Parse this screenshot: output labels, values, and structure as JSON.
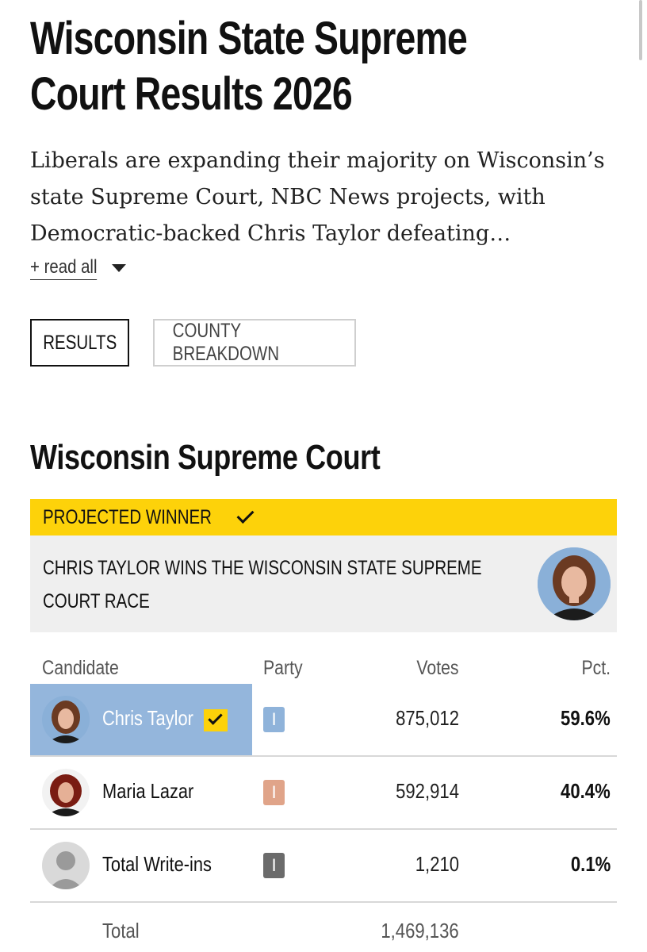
{
  "page": {
    "title_line1": "Wisconsin State Supreme",
    "title_line2": "Court Results 2026",
    "summary": "Liberals are expanding their majority on Wisconsin’s state Supreme Court, NBC News projects, with Democratic-backed Chris Taylor defeating…",
    "read_all_label": "+ read all"
  },
  "tabs": [
    {
      "label": "RESULTS",
      "active": true
    },
    {
      "label": "COUNTY BREAKDOWN",
      "active": false
    }
  ],
  "race": {
    "title": "Wisconsin Supreme Court",
    "projected_label": "PROJECTED WINNER",
    "winner_line1": "CHRIS TAYLOR WINS THE WISCONSIN STATE SUPREME",
    "winner_line2": "COURT RACE",
    "columns": {
      "candidate": "Candidate",
      "party": "Party",
      "votes": "Votes",
      "pct": "Pct."
    },
    "candidates": [
      {
        "name": "Chris Taylor",
        "party": "I",
        "party_color": "#8fb3da",
        "votes": "875,012",
        "pct": "59.6%",
        "winner": true
      },
      {
        "name": "Maria Lazar",
        "party": "I",
        "party_color": "#e0a489",
        "votes": "592,914",
        "pct": "40.4%",
        "winner": false
      },
      {
        "name": "Total Write-ins",
        "party": "I",
        "party_color": "#6b6b6b",
        "votes": "1,210",
        "pct": "0.1%",
        "winner": false
      }
    ],
    "total_label": "Total",
    "total_votes": "1,469,136"
  },
  "colors": {
    "projected_bar": "#fdd20a",
    "winner_highlight": "#94b6dc",
    "winner_box": "#efefef"
  },
  "icons": {
    "read_all": "chevron-down-icon",
    "projected": "check-icon",
    "winner_row": "check-icon"
  }
}
